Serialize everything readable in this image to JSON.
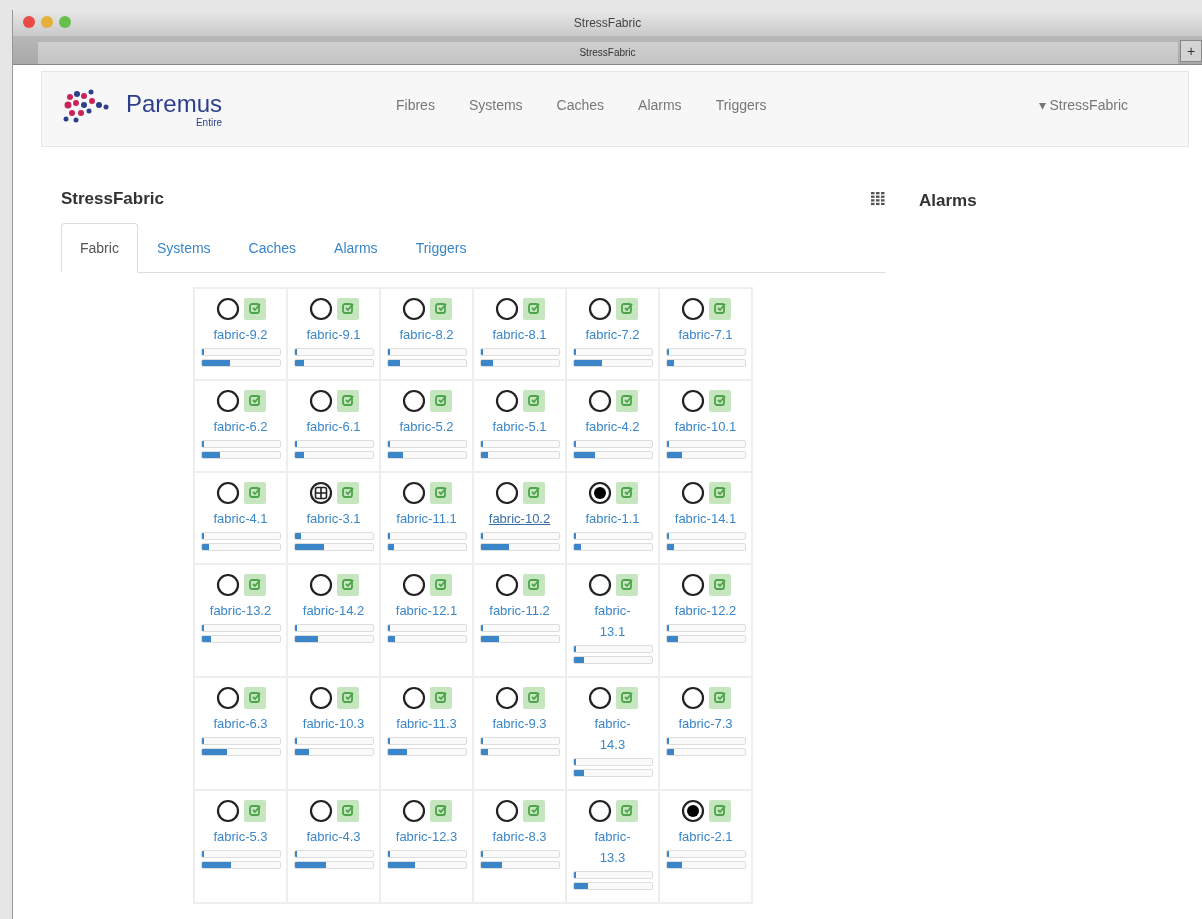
{
  "window": {
    "title": "StressFabric",
    "tab": "StressFabric",
    "new_tab": "+"
  },
  "navbar": {
    "brand": "Paremus",
    "brand_sub": "Entire",
    "links": [
      "Fibres",
      "Systems",
      "Caches",
      "Alarms",
      "Triggers"
    ],
    "user_menu": {
      "caret": "▾",
      "label": "StressFabric"
    }
  },
  "main": {
    "title": "StressFabric",
    "tabs": [
      {
        "label": "Fabric",
        "selected": true
      },
      {
        "label": "Systems",
        "selected": false
      },
      {
        "label": "Caches",
        "selected": false
      },
      {
        "label": "Alarms",
        "selected": false
      },
      {
        "label": "Triggers",
        "selected": false
      }
    ],
    "nodes": [
      {
        "name": "fabric-9.2",
        "kind": "empty",
        "hover": false,
        "bars": [
          {
            "level": 0.03
          },
          {
            "level": 0.36
          }
        ]
      },
      {
        "name": "fabric-9.1",
        "kind": "empty",
        "hover": false,
        "bars": [
          {
            "level": 0.03
          },
          {
            "level": 0.12
          }
        ]
      },
      {
        "name": "fabric-8.2",
        "kind": "empty",
        "hover": false,
        "bars": [
          {
            "level": 0.03
          },
          {
            "level": 0.16
          }
        ]
      },
      {
        "name": "fabric-8.1",
        "kind": "empty",
        "hover": false,
        "bars": [
          {
            "level": 0.03
          },
          {
            "level": 0.16
          }
        ]
      },
      {
        "name": "fabric-7.2",
        "kind": "empty",
        "hover": false,
        "bars": [
          {
            "level": 0.03
          },
          {
            "level": 0.36
          }
        ]
      },
      {
        "name": "fabric-7.1",
        "kind": "empty",
        "hover": false,
        "bars": [
          {
            "level": 0.03
          },
          {
            "level": 0.1
          }
        ]
      },
      {
        "name": "fabric-6.2",
        "kind": "empty",
        "hover": false,
        "bars": [
          {
            "level": 0.03
          },
          {
            "level": 0.24
          }
        ]
      },
      {
        "name": "fabric-6.1",
        "kind": "empty",
        "hover": false,
        "bars": [
          {
            "level": 0.03
          },
          {
            "level": 0.12
          }
        ]
      },
      {
        "name": "fabric-5.2",
        "kind": "empty",
        "hover": false,
        "bars": [
          {
            "level": 0.03
          },
          {
            "level": 0.2
          }
        ]
      },
      {
        "name": "fabric-5.1",
        "kind": "empty",
        "hover": false,
        "bars": [
          {
            "level": 0.03
          },
          {
            "level": 0.1
          }
        ]
      },
      {
        "name": "fabric-4.2",
        "kind": "empty",
        "hover": false,
        "bars": [
          {
            "level": 0.03
          },
          {
            "level": 0.27
          }
        ]
      },
      {
        "name": "fabric-10.1",
        "kind": "empty",
        "hover": false,
        "bars": [
          {
            "level": 0.03
          },
          {
            "level": 0.2
          }
        ]
      },
      {
        "name": "fabric-4.1",
        "kind": "empty",
        "hover": false,
        "bars": [
          {
            "level": 0.03
          },
          {
            "level": 0.1
          }
        ]
      },
      {
        "name": "fabric-3.1",
        "kind": "grid",
        "hover": false,
        "bars": [
          {
            "level": 0.08
          },
          {
            "level": 0.38
          }
        ]
      },
      {
        "name": "fabric-11.1",
        "kind": "empty",
        "hover": false,
        "bars": [
          {
            "level": 0.03
          },
          {
            "level": 0.08
          }
        ]
      },
      {
        "name": "fabric-10.2",
        "kind": "empty",
        "hover": true,
        "bars": [
          {
            "level": 0.03
          },
          {
            "level": 0.37
          }
        ]
      },
      {
        "name": "fabric-1.1",
        "kind": "dot",
        "hover": false,
        "bars": [
          {
            "level": 0.03
          },
          {
            "level": 0.1
          }
        ]
      },
      {
        "name": "fabric-14.1",
        "kind": "empty",
        "hover": false,
        "bars": [
          {
            "level": 0.03
          },
          {
            "level": 0.1
          }
        ]
      },
      {
        "name": "fabric-13.2",
        "kind": "empty",
        "hover": false,
        "bars": [
          {
            "level": 0.03
          },
          {
            "level": 0.12
          }
        ]
      },
      {
        "name": "fabric-14.2",
        "kind": "empty",
        "hover": false,
        "bars": [
          {
            "level": 0.03
          },
          {
            "level": 0.3
          }
        ]
      },
      {
        "name": "fabric-12.1",
        "kind": "empty",
        "hover": false,
        "bars": [
          {
            "level": 0.03
          },
          {
            "level": 0.1
          }
        ]
      },
      {
        "name": "fabric-11.2",
        "kind": "empty",
        "hover": false,
        "bars": [
          {
            "level": 0.03
          },
          {
            "level": 0.24
          }
        ]
      },
      {
        "name": "fabric-13.1",
        "kind": "empty",
        "hover": false,
        "bars": [
          {
            "level": 0.03
          },
          {
            "level": 0.14
          }
        ]
      },
      {
        "name": "fabric-12.2",
        "kind": "empty",
        "hover": false,
        "bars": [
          {
            "level": 0.03
          },
          {
            "level": 0.15
          }
        ]
      },
      {
        "name": "fabric-6.3",
        "kind": "empty",
        "hover": false,
        "bars": [
          {
            "level": 0.03
          },
          {
            "level": 0.33
          }
        ]
      },
      {
        "name": "fabric-10.3",
        "kind": "empty",
        "hover": false,
        "bars": [
          {
            "level": 0.03
          },
          {
            "level": 0.19
          }
        ]
      },
      {
        "name": "fabric-11.3",
        "kind": "empty",
        "hover": false,
        "bars": [
          {
            "level": 0.03
          },
          {
            "level": 0.25
          }
        ]
      },
      {
        "name": "fabric-9.3",
        "kind": "empty",
        "hover": false,
        "bars": [
          {
            "level": 0.03
          },
          {
            "level": 0.1
          }
        ]
      },
      {
        "name": "fabric-14.3",
        "kind": "empty",
        "hover": false,
        "bars": [
          {
            "level": 0.03
          },
          {
            "level": 0.14
          }
        ]
      },
      {
        "name": "fabric-7.3",
        "kind": "empty",
        "hover": false,
        "bars": [
          {
            "level": 0.03
          },
          {
            "level": 0.1
          }
        ]
      },
      {
        "name": "fabric-5.3",
        "kind": "empty",
        "hover": false,
        "bars": [
          {
            "level": 0.03
          },
          {
            "level": 0.38
          }
        ]
      },
      {
        "name": "fabric-4.3",
        "kind": "empty",
        "hover": false,
        "bars": [
          {
            "level": 0.03
          },
          {
            "level": 0.4
          }
        ]
      },
      {
        "name": "fabric-12.3",
        "kind": "empty",
        "hover": false,
        "bars": [
          {
            "level": 0.03
          },
          {
            "level": 0.35
          }
        ]
      },
      {
        "name": "fabric-8.3",
        "kind": "empty",
        "hover": false,
        "bars": [
          {
            "level": 0.03
          },
          {
            "level": 0.28
          }
        ]
      },
      {
        "name": "fabric-13.3",
        "kind": "empty",
        "hover": false,
        "bars": [
          {
            "level": 0.03
          },
          {
            "level": 0.18
          }
        ]
      },
      {
        "name": "fabric-2.1",
        "kind": "dot",
        "hover": false,
        "bars": [
          {
            "level": 0.03
          },
          {
            "level": 0.2
          }
        ]
      }
    ]
  },
  "side": {
    "title": "Alarms"
  }
}
